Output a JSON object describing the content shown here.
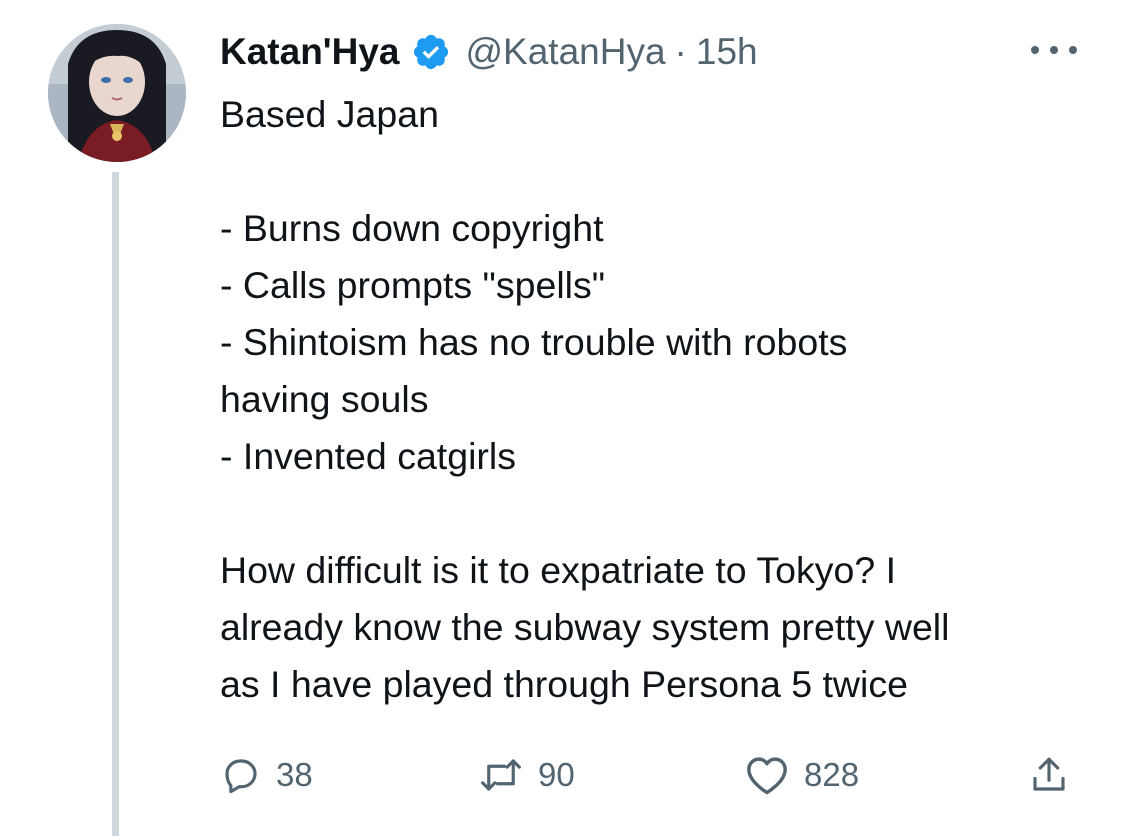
{
  "tweet": {
    "author_name": "Katan'Hya",
    "handle": "@KatanHya",
    "separator": "·",
    "time": "15h",
    "text": {
      "line1": "Based Japan",
      "line2": "- Burns down copyright",
      "line3": "- Calls prompts \"spells\"",
      "line4": "- Shintoism has no trouble with robots",
      "line5": "having souls",
      "line6": "- Invented catgirls",
      "line7": "How difficult is it to expatriate to Tokyo? I",
      "line8": "already know the subway system pretty well",
      "line9": "as I have played through Persona 5 twice"
    }
  },
  "actions": {
    "replies": "38",
    "retweets": "90",
    "likes": "828"
  },
  "icons": {
    "verified": "verified-badge-icon",
    "more": "more-horizontal-icon",
    "reply": "reply-icon",
    "retweet": "retweet-icon",
    "like": "heart-icon",
    "share": "share-icon"
  },
  "colors": {
    "verified_blue": "#1d9bf0",
    "muted_text": "#536471",
    "thread_line": "#cfd9de"
  }
}
